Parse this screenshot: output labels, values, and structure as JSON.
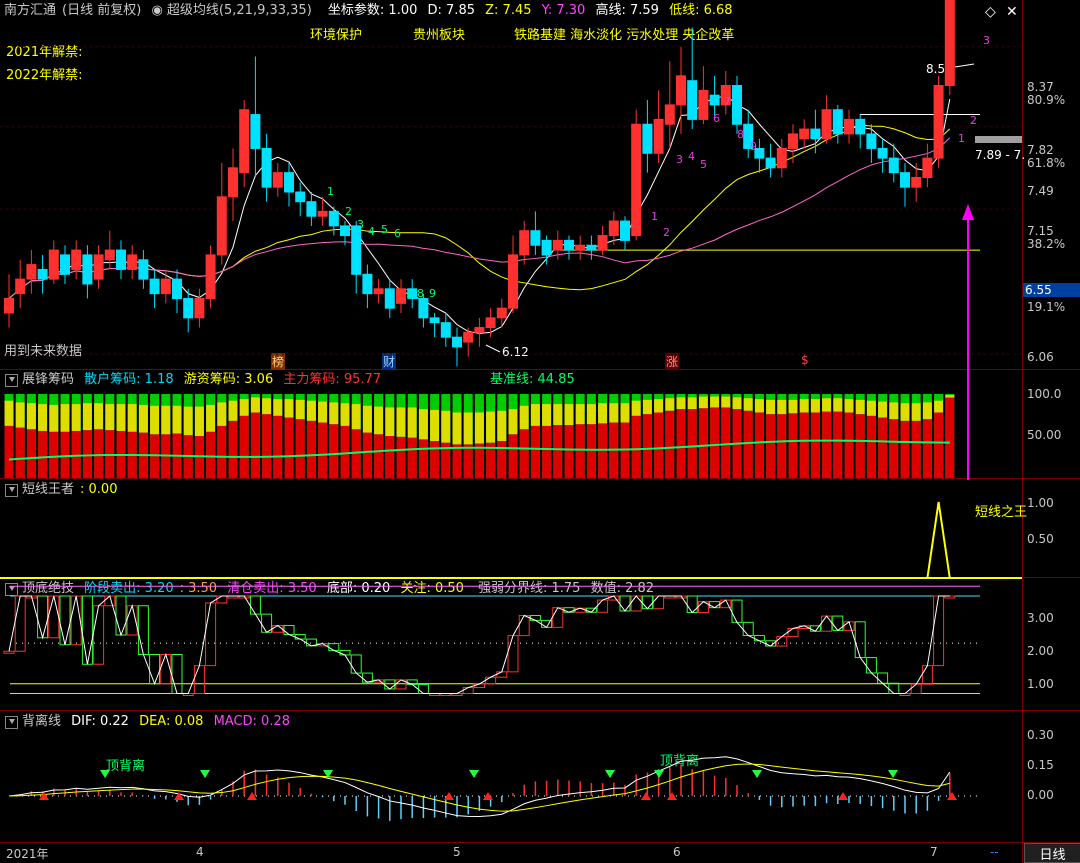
{
  "header": {
    "title": "南方汇通",
    "period": "(日线 前复权)",
    "indicator": "超级均线(5,21,9,33,35)",
    "coord_label": "坐标参数: 1.00",
    "d": "D: 7.85",
    "z": "Z: 7.45",
    "y": "Y: 7.30",
    "high": "高线: 7.59",
    "low": "低线: 6.68"
  },
  "concepts": [
    "环境保护",
    "贵州板块",
    "铁路基建 海水淡化 污水处理 央企改革"
  ],
  "unlock": [
    "2021年解禁:",
    "2022年解禁:"
  ],
  "main": {
    "future_label": "用到未来数据",
    "price_axis": [
      "8.37",
      "80.9%",
      "7.82",
      "61.8%",
      "7.49",
      "7.15",
      "38.2%",
      "6.55",
      "19.1%",
      "6.06"
    ],
    "max_label": "8.57",
    "min_label": "6.12",
    "range_label": "7.89 - 7.",
    "events": [
      "榜",
      "财",
      "涨",
      "$"
    ],
    "seq_numbers": [
      "1",
      "2",
      "3",
      "4",
      "5",
      "6",
      "7",
      "8",
      "9"
    ]
  },
  "panel1": {
    "name": "展锋筹码",
    "retail": "散户筹码: 1.18",
    "hot": "游资筹码: 3.06",
    "main": "主力筹码: 95.77",
    "base": "基准线: 44.85",
    "axis": [
      "100.0",
      "50.00"
    ]
  },
  "panel2": {
    "name": "短线王者",
    "value": ": 0.00",
    "tag": "短线之王",
    "axis": [
      "1.00",
      "0.50"
    ]
  },
  "panel3": {
    "name": "顶底绝技",
    "stage_sell": "阶段卖出: 3.20",
    "v350": ": 3.50",
    "clear_sell": "清仓卖出: 3.50",
    "bottom": "底部: 0.20",
    "focus": "关注: 0.50",
    "line": "强弱分界线: 1.75",
    "value": "数值: 2.82",
    "axis": [
      "3.00",
      "2.00",
      "1.00"
    ]
  },
  "panel4": {
    "name": "背离线",
    "dif": "DIF: 0.22",
    "dea": "DEA: 0.08",
    "macd": "MACD: 0.28",
    "div_label": "顶背离",
    "axis": [
      "0.30",
      "0.15",
      "0.00"
    ]
  },
  "xaxis": {
    "year": "2021年",
    "months": [
      "4",
      "5",
      "6",
      "7"
    ],
    "period_btn": "日线",
    "dash": "--"
  },
  "chart_data": {
    "type": "candlestick",
    "ohlc": [
      [
        6.72,
        6.78,
        6.66,
        6.88
      ],
      [
        6.8,
        6.86,
        6.74,
        6.94
      ],
      [
        6.86,
        6.92,
        6.8,
        6.98
      ],
      [
        6.9,
        6.86,
        6.8,
        6.96
      ],
      [
        6.86,
        6.98,
        6.84,
        7.02
      ],
      [
        6.96,
        6.88,
        6.84,
        7.0
      ],
      [
        6.9,
        6.98,
        6.86,
        7.02
      ],
      [
        6.96,
        6.84,
        6.78,
        7.0
      ],
      [
        6.86,
        6.96,
        6.82,
        7.0
      ],
      [
        6.94,
        6.98,
        6.9,
        7.06
      ],
      [
        6.98,
        6.9,
        6.86,
        7.02
      ],
      [
        6.9,
        6.96,
        6.86,
        7.0
      ],
      [
        6.94,
        6.86,
        6.82,
        6.98
      ],
      [
        6.86,
        6.8,
        6.74,
        6.9
      ],
      [
        6.8,
        6.86,
        6.76,
        6.9
      ],
      [
        6.86,
        6.78,
        6.72,
        6.9
      ],
      [
        6.78,
        6.7,
        6.64,
        6.82
      ],
      [
        6.7,
        6.78,
        6.66,
        6.82
      ],
      [
        6.78,
        6.96,
        6.74,
        7.0
      ],
      [
        6.96,
        7.2,
        6.92,
        7.34
      ],
      [
        7.2,
        7.32,
        7.1,
        7.4
      ],
      [
        7.3,
        7.56,
        7.24,
        7.6
      ],
      [
        7.54,
        7.4,
        7.28,
        7.78
      ],
      [
        7.4,
        7.24,
        7.18,
        7.46
      ],
      [
        7.24,
        7.3,
        7.2,
        7.34
      ],
      [
        7.3,
        7.22,
        7.16,
        7.34
      ],
      [
        7.22,
        7.18,
        7.12,
        7.26
      ],
      [
        7.18,
        7.12,
        7.08,
        7.22
      ],
      [
        7.12,
        7.14,
        7.08,
        7.2
      ],
      [
        7.14,
        7.08,
        7.04,
        7.16
      ],
      [
        7.08,
        7.04,
        7.0,
        7.1
      ],
      [
        7.08,
        6.88,
        6.8,
        7.1
      ],
      [
        6.88,
        6.8,
        6.74,
        6.92
      ],
      [
        6.8,
        6.82,
        6.76,
        6.86
      ],
      [
        6.82,
        6.74,
        6.7,
        6.86
      ],
      [
        6.76,
        6.82,
        6.72,
        6.86
      ],
      [
        6.82,
        6.78,
        6.74,
        6.86
      ],
      [
        6.78,
        6.7,
        6.66,
        6.8
      ],
      [
        6.7,
        6.68,
        6.62,
        6.72
      ],
      [
        6.68,
        6.62,
        6.58,
        6.72
      ],
      [
        6.62,
        6.58,
        6.5,
        6.66
      ],
      [
        6.6,
        6.64,
        6.54,
        6.66
      ],
      [
        6.64,
        6.66,
        6.58,
        6.7
      ],
      [
        6.66,
        6.7,
        6.62,
        6.74
      ],
      [
        6.7,
        6.74,
        6.66,
        6.78
      ],
      [
        6.74,
        6.96,
        6.72,
        7.04
      ],
      [
        6.96,
        7.06,
        6.92,
        7.1
      ],
      [
        7.06,
        7.0,
        6.96,
        7.14
      ],
      [
        7.02,
        6.96,
        6.92,
        7.04
      ],
      [
        6.98,
        7.02,
        6.94,
        7.06
      ],
      [
        7.02,
        6.98,
        6.94,
        7.04
      ],
      [
        6.98,
        7.0,
        6.94,
        7.04
      ],
      [
        7.0,
        6.98,
        6.94,
        7.04
      ],
      [
        6.98,
        7.04,
        6.96,
        7.08
      ],
      [
        7.04,
        7.1,
        7.0,
        7.14
      ],
      [
        7.1,
        7.02,
        6.98,
        7.12
      ],
      [
        7.04,
        7.5,
        7.02,
        7.56
      ],
      [
        7.5,
        7.38,
        7.3,
        7.6
      ],
      [
        7.38,
        7.52,
        7.34,
        7.64
      ],
      [
        7.5,
        7.58,
        7.4,
        7.76
      ],
      [
        7.58,
        7.7,
        7.46,
        7.82
      ],
      [
        7.68,
        7.52,
        7.48,
        7.9
      ],
      [
        7.52,
        7.64,
        7.5,
        7.74
      ],
      [
        7.62,
        7.58,
        7.52,
        7.7
      ],
      [
        7.58,
        7.66,
        7.54,
        7.72
      ],
      [
        7.66,
        7.5,
        7.46,
        7.7
      ],
      [
        7.5,
        7.4,
        7.36,
        7.56
      ],
      [
        7.4,
        7.36,
        7.3,
        7.44
      ],
      [
        7.36,
        7.32,
        7.28,
        7.42
      ],
      [
        7.32,
        7.4,
        7.28,
        7.44
      ],
      [
        7.4,
        7.46,
        7.34,
        7.5
      ],
      [
        7.44,
        7.48,
        7.4,
        7.52
      ],
      [
        7.48,
        7.44,
        7.38,
        7.56
      ],
      [
        7.44,
        7.56,
        7.42,
        7.62
      ],
      [
        7.56,
        7.46,
        7.42,
        7.58
      ],
      [
        7.46,
        7.52,
        7.42,
        7.56
      ],
      [
        7.52,
        7.46,
        7.4,
        7.54
      ],
      [
        7.46,
        7.4,
        7.34,
        7.5
      ],
      [
        7.4,
        7.36,
        7.3,
        7.44
      ],
      [
        7.36,
        7.3,
        7.26,
        7.42
      ],
      [
        7.3,
        7.24,
        7.16,
        7.34
      ],
      [
        7.24,
        7.28,
        7.18,
        7.34
      ],
      [
        7.28,
        7.36,
        7.24,
        7.42
      ],
      [
        7.36,
        7.66,
        7.32,
        7.7
      ],
      [
        7.66,
        8.48,
        7.62,
        8.57
      ]
    ],
    "ma": [
      {
        "name": "white",
        "color": "#ffffff"
      },
      {
        "name": "yellow",
        "color": "#ffff00"
      },
      {
        "name": "pink",
        "color": "#ff66cc"
      }
    ],
    "chips_main": [
      62,
      60,
      58,
      56,
      55,
      55,
      56,
      57,
      58,
      57,
      56,
      55,
      54,
      52,
      52,
      53,
      51,
      50,
      55,
      62,
      68,
      74,
      78,
      76,
      74,
      72,
      70,
      68,
      66,
      64,
      62,
      58,
      54,
      52,
      50,
      49,
      48,
      46,
      44,
      42,
      40,
      40,
      41,
      42,
      44,
      52,
      58,
      62,
      62,
      63,
      63,
      64,
      64,
      65,
      66,
      66,
      74,
      76,
      78,
      80,
      82,
      82,
      83,
      84,
      84,
      82,
      80,
      78,
      76,
      76,
      77,
      78,
      78,
      79,
      79,
      78,
      76,
      74,
      72,
      70,
      68,
      68,
      70,
      78,
      95.77
    ],
    "chips_mid": [
      30,
      30,
      31,
      32,
      32,
      33,
      32,
      32,
      31,
      31,
      32,
      33,
      33,
      34,
      34,
      33,
      34,
      35,
      32,
      28,
      24,
      20,
      18,
      19,
      20,
      22,
      23,
      24,
      25,
      26,
      27,
      30,
      32,
      33,
      34,
      35,
      36,
      36,
      37,
      38,
      38,
      38,
      37,
      37,
      36,
      30,
      28,
      26,
      26,
      25,
      25,
      24,
      24,
      24,
      23,
      23,
      18,
      17,
      16,
      15,
      14,
      14,
      14,
      13,
      13,
      14,
      15,
      16,
      17,
      17,
      16,
      16,
      16,
      16,
      16,
      16,
      17,
      18,
      19,
      20,
      21,
      21,
      20,
      14,
      3.06
    ],
    "baseline_end": 44.85,
    "shortking_spike_index": 83,
    "topbottom_axis_range": [
      0,
      3.5
    ],
    "macd_axis_range": [
      -0.05,
      0.32
    ]
  }
}
